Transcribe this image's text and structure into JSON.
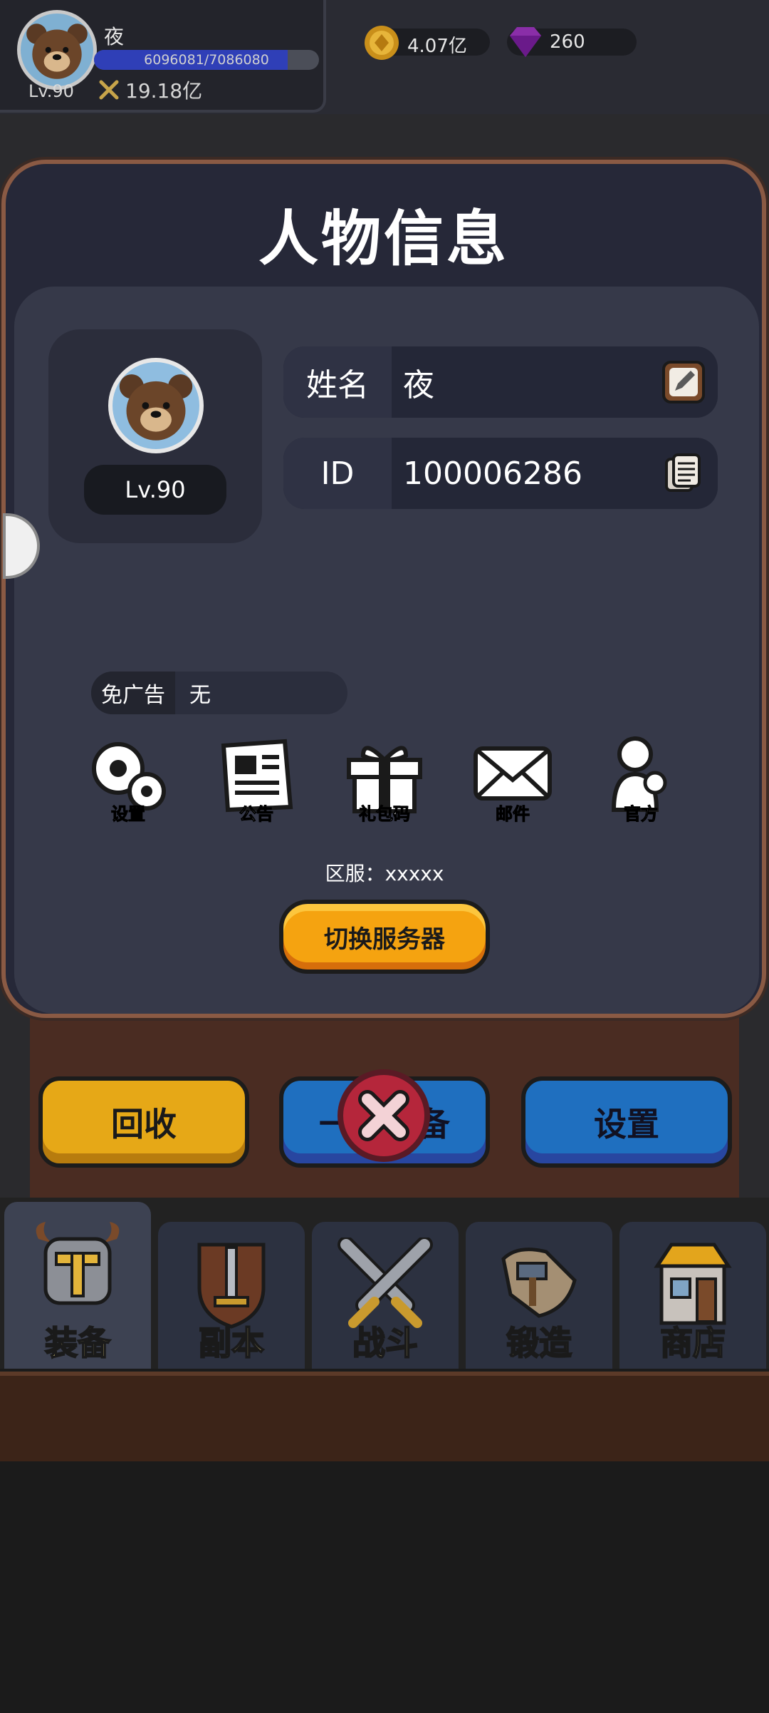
{
  "player": {
    "name": "夜",
    "level_label": "Lv.90",
    "exp_text": "6096081/7086080",
    "exp_fraction": 0.86,
    "power": "19.18亿"
  },
  "resources": {
    "gold": "4.07亿",
    "gems": "260"
  },
  "modal": {
    "title": "人物信息",
    "level_label": "Lv.90",
    "name_key": "姓名",
    "name_value": "夜",
    "id_key": "ID",
    "id_value": "100006286",
    "noad_key": "免广告",
    "noad_value": "无",
    "menu": [
      {
        "label": "设置",
        "icon": "gear-icon"
      },
      {
        "label": "公告",
        "icon": "newspaper-icon"
      },
      {
        "label": "礼包码",
        "icon": "gift-icon"
      },
      {
        "label": "邮件",
        "icon": "mail-icon"
      },
      {
        "label": "官方",
        "icon": "person-icon"
      }
    ],
    "server_text": "区服：xxxxx",
    "switch_label": "切换服务器"
  },
  "bottom_buttons": {
    "recycle": "回收",
    "one_click": "一键装备",
    "settings": "设置"
  },
  "tabs": [
    {
      "label": "装备",
      "icon": "helmet-icon"
    },
    {
      "label": "副本",
      "icon": "sword-shield-icon"
    },
    {
      "label": "战斗",
      "icon": "crossed-swords-icon"
    },
    {
      "label": "锻造",
      "icon": "scroll-hammer-icon"
    },
    {
      "label": "商店",
      "icon": "shop-icon"
    }
  ],
  "colors": {
    "accent_orange": "#f5a310",
    "modal_bg": "#262838",
    "modal_border": "#8a5a44"
  }
}
